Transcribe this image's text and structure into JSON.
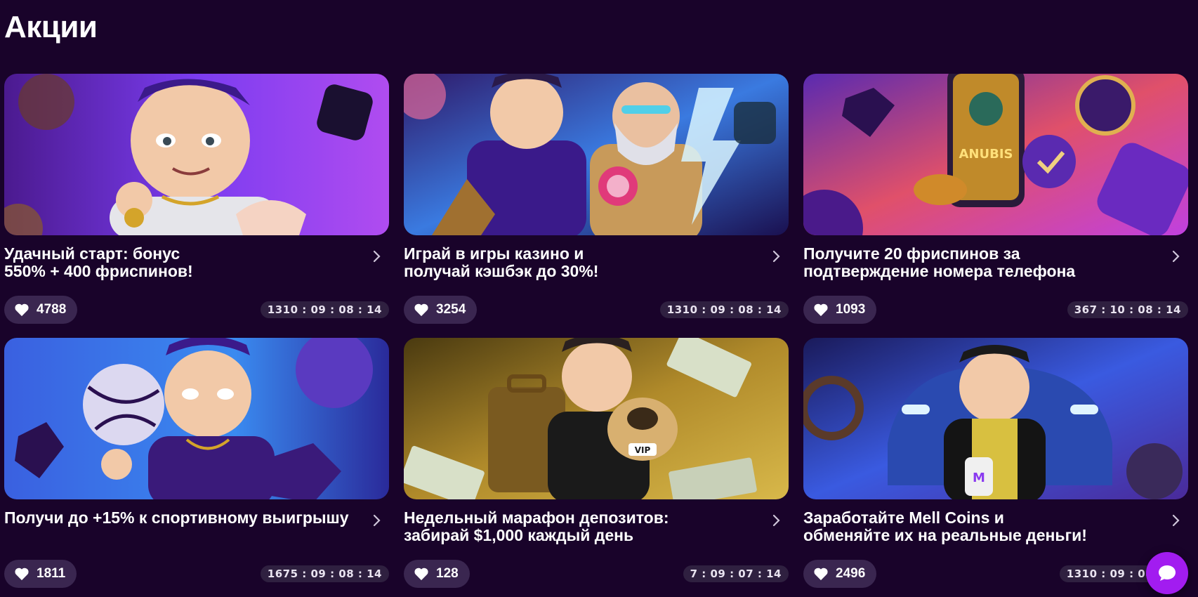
{
  "page": {
    "title": "Акции"
  },
  "colors": {
    "background": "#19032a",
    "accent": "#a21cf0",
    "pill": "#3a2650"
  },
  "promos": [
    {
      "title": "Удачный старт: бонус\n550% + 400 фриспинов!",
      "likes": "4788",
      "timer": "1310 : 09 : 08 : 14"
    },
    {
      "title": "Играй в игры казино и\nполучай кэшбэк до 30%!",
      "likes": "3254",
      "timer": "1310 : 09 : 08 : 14"
    },
    {
      "title": "Получите 20 фриспинов за\nподтверждение номера телефона",
      "likes": "1093",
      "timer": "367 : 10 : 08 : 14"
    },
    {
      "title": "Получи до +15% к спортивному выигрышу",
      "likes": "1811",
      "timer": "1675 : 09 : 08 : 14"
    },
    {
      "title": "Недельный марафон депозитов:\nзабирай $1,000 каждый день",
      "likes": "128",
      "timer": "7 : 09 : 07 : 14"
    },
    {
      "title": "Заработайте Mell Coins и\nобменяйте их на реальные деньги!",
      "likes": "2496",
      "timer": "1310 : 09 : 08 : 14"
    }
  ],
  "icons": {
    "like": "heart-icon",
    "more": "chevron-right-icon",
    "chat": "chat-bubble-icon"
  }
}
